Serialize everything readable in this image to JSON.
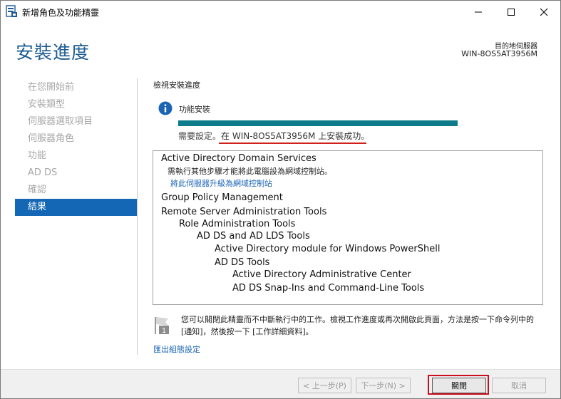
{
  "window": {
    "title": "新增角色及功能精靈",
    "minimize_icon": "minimize-icon",
    "maximize_icon": "maximize-icon",
    "close_icon": "close-icon"
  },
  "header": {
    "page_title": "安裝進度",
    "destination_label": "目的地伺服器",
    "destination_server": "WIN-8OS5AT3956M"
  },
  "nav": {
    "items": [
      {
        "label": "在您開始前",
        "active": false
      },
      {
        "label": "安裝類型",
        "active": false
      },
      {
        "label": "伺服器選取項目",
        "active": false
      },
      {
        "label": "伺服器角色",
        "active": false
      },
      {
        "label": "功能",
        "active": false
      },
      {
        "label": "AD DS",
        "active": false
      },
      {
        "label": "確認",
        "active": false
      },
      {
        "label": "結果",
        "active": true
      }
    ]
  },
  "main": {
    "heading": "檢視安裝進度",
    "feature_install_label": "功能安裝",
    "progress_fraction": 1.0,
    "status_prefix": "需要設定。",
    "status_success": "在 WIN-8OS5AT3956M 上安裝成功。",
    "results": [
      {
        "text": "Active Directory Domain Services",
        "level": 0,
        "kind": "big"
      },
      {
        "text": "需執行其他步驟才能將此電腦設為網域控制站。",
        "level": 0,
        "kind": "small"
      },
      {
        "text": "將此伺服器升級為網域控制站",
        "level": 0,
        "kind": "link"
      },
      {
        "text": "Group Policy Management",
        "level": 0,
        "kind": "big"
      },
      {
        "text": "Remote Server Administration Tools",
        "level": 0,
        "kind": "big"
      },
      {
        "text": "Role Administration Tools",
        "level": 1,
        "kind": "big"
      },
      {
        "text": "AD DS and AD LDS Tools",
        "level": 2,
        "kind": "big"
      },
      {
        "text": "Active Directory module for Windows PowerShell",
        "level": 3,
        "kind": "big"
      },
      {
        "text": "AD DS Tools",
        "level": 3,
        "kind": "big"
      },
      {
        "text": "Active Directory Administrative Center",
        "level": 4,
        "kind": "big"
      },
      {
        "text": "AD DS Snap-Ins and Command-Line Tools",
        "level": 4,
        "kind": "big"
      }
    ],
    "note": "您可以關閉此精靈而不中斷執行中的工作。檢視工作進度或再次開啟此頁面，方法是按一下命令列中的 [通知]，然後按一下 [工作詳細資料]。",
    "flag_badge": "1",
    "export_link": "匯出組態設定"
  },
  "footer": {
    "prev_label": "< 上一步(P)",
    "next_label": "下一步(N) >",
    "close_label": "關閉",
    "cancel_label": "取消"
  },
  "colors": {
    "title_blue": "#1c5c93",
    "nav_active": "#1467b5",
    "progress": "#0e7b8a",
    "link": "#1a64b4",
    "highlight_red": "#c8101f"
  }
}
